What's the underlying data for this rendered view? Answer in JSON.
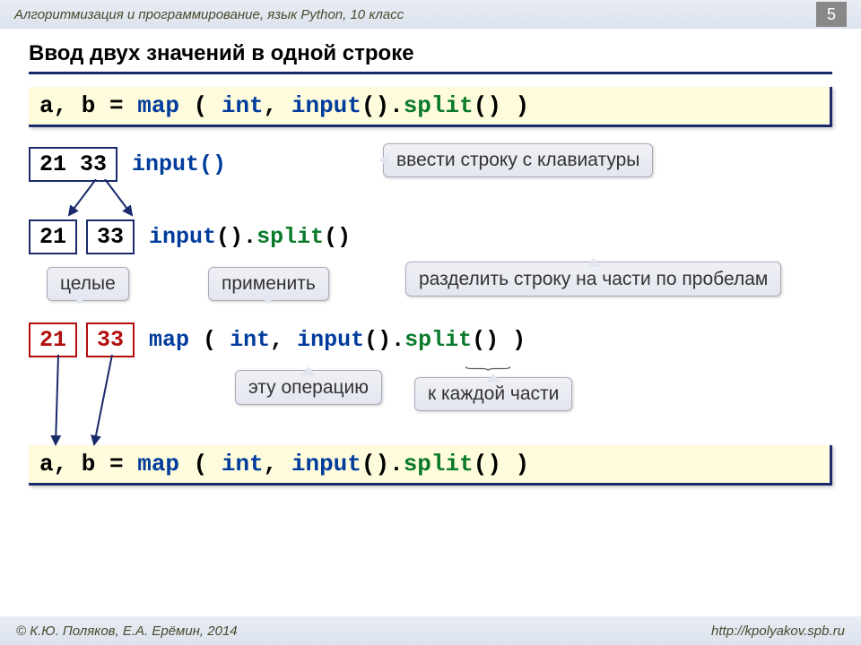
{
  "header": {
    "course": "Алгоритмизация и программирование, язык Python, 10 класс",
    "page": "5"
  },
  "title": "Ввод двух значений в одной строке",
  "code_main_parts": {
    "ab": "a, b = ",
    "map": "map",
    "lp": " ( ",
    "int": "int",
    "comma": ", ",
    "input": "input",
    "paren": "().",
    "split": "split",
    "end": "() )",
    "inputcall": "input()",
    "inputsplit": "input().split()"
  },
  "values": {
    "combined": "21 33",
    "v1": "21",
    "v2": "33"
  },
  "annot": {
    "input_desc": "ввести строку с клавиатуры",
    "split_desc": "разделить строку на части по пробелам",
    "int_label": "целые",
    "apply_label": "применить",
    "this_op": "эту операцию",
    "each_part": "к каждой части"
  },
  "footer": {
    "copyright": "© К.Ю. Поляков, Е.А. Ерёмин, 2014",
    "url": "http://kpolyakov.spb.ru"
  }
}
